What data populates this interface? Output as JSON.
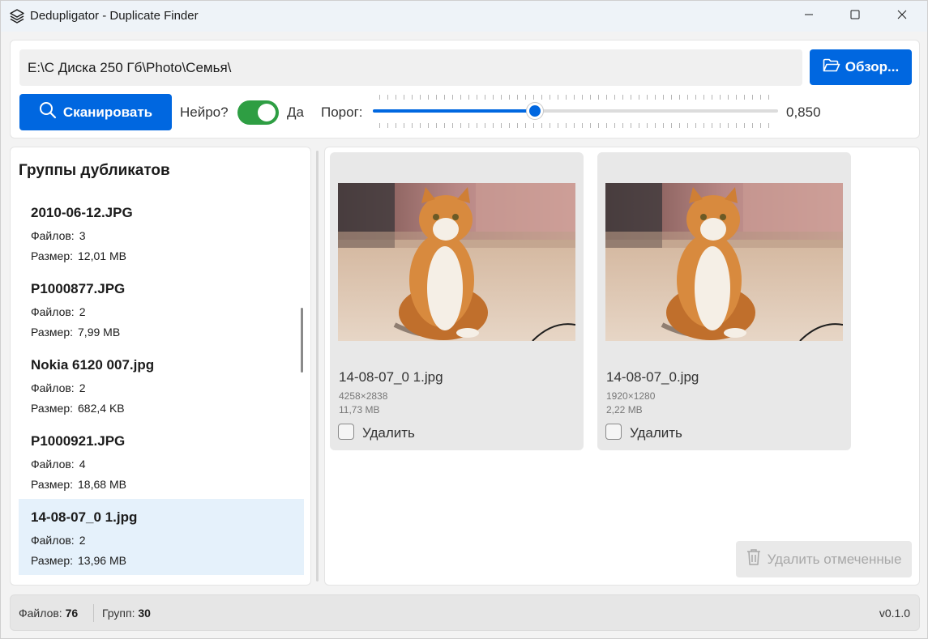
{
  "window": {
    "title": "Dedupligator - Duplicate Finder",
    "icons": {
      "app": "layers-icon",
      "minimize": "minimize-icon",
      "maximize": "maximize-icon",
      "close": "close-icon"
    }
  },
  "toolbar": {
    "path_value": "E:\\C Диска 250 Гб\\Photo\\Семья\\",
    "browse_label": "Обзор...",
    "scan_label": "Сканировать",
    "neuro_label": "Нейро?",
    "neuro_enabled": true,
    "neuro_state_label": "Да",
    "threshold_label": "Порог:",
    "threshold_value": "0,850",
    "threshold_fill_fraction": 0.4,
    "accent_color": "#0067e0",
    "toggle_color": "#2e9e43"
  },
  "groups": {
    "title": "Группы дубликатов",
    "files_key": "Файлов:",
    "size_key": "Размер:",
    "items": [
      {
        "name": "2010-06-12.JPG",
        "files": "3",
        "size": "12,01 MB",
        "selected": false
      },
      {
        "name": "P1000877.JPG",
        "files": "2",
        "size": "7,99 MB",
        "selected": false
      },
      {
        "name": "Nokia 6120 007.jpg",
        "files": "2",
        "size": "682,4 KB",
        "selected": false
      },
      {
        "name": "P1000921.JPG",
        "files": "4",
        "size": "18,68 MB",
        "selected": false
      },
      {
        "name": "14-08-07_0 1.jpg",
        "files": "2",
        "size": "13,96 MB",
        "selected": true
      }
    ]
  },
  "files": {
    "delete_label": "Удалить",
    "cards": [
      {
        "name": "14-08-07_0 1.jpg",
        "dims": "4258×2838",
        "size": "11,73 MB"
      },
      {
        "name": "14-08-07_0.jpg",
        "dims": "1920×1280",
        "size": "2,22 MB"
      }
    ],
    "delete_marked_label": "Удалить отмеченные"
  },
  "status": {
    "files_label": "Файлов:",
    "files_value": "76",
    "groups_label": "Групп:",
    "groups_value": "30",
    "version": "v0.1.0"
  }
}
